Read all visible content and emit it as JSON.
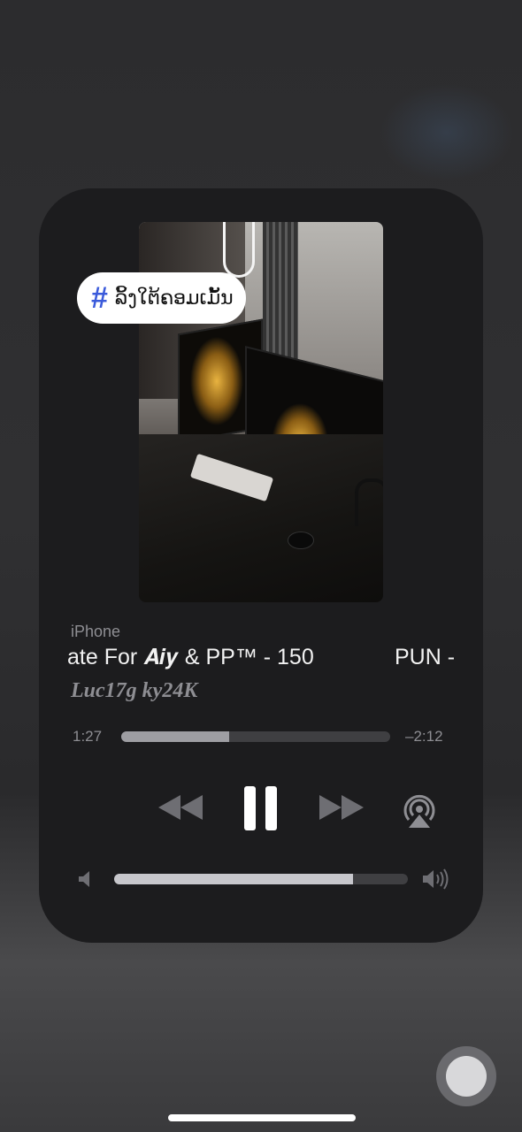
{
  "tag": {
    "icon": "hashtag-icon",
    "label": "ລິ້ງໃຕ້ຄອມເມັ້ນ",
    "hash_color": "#3b5bdb"
  },
  "now_playing": {
    "device": "iPhone",
    "title_visible": "ate For 𝑨𝒊𝒚 & PP™ - 150",
    "title_next": "PUN - G",
    "artist": "Luc17g ky24K",
    "elapsed": "1:27",
    "remaining": "–2:12",
    "progress": 0.4
  },
  "controls": {
    "rewind": "rewind-icon",
    "pause": "pause-icon",
    "forward": "fast-forward-icon",
    "airplay": "airplay-icon"
  },
  "volume": {
    "level": 0.813,
    "low_icon": "volume-low-icon",
    "high_icon": "volume-high-icon"
  }
}
